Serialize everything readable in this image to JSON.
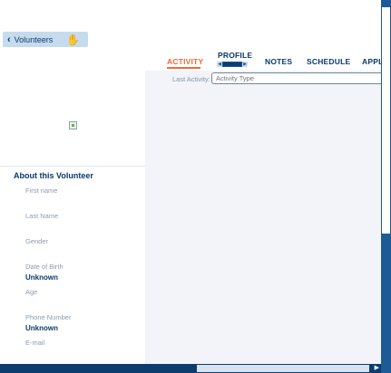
{
  "nav": {
    "back_label": "Volunteers",
    "back_chevron": "‹",
    "hand_icon": "✋"
  },
  "tabs": [
    {
      "label": "ACTIVITY",
      "active": true
    },
    {
      "label": "PROFILE",
      "active": false
    },
    {
      "label": "NOTES",
      "active": false
    },
    {
      "label": "SCHEDULE",
      "active": false
    },
    {
      "label": "APPL",
      "active": false
    }
  ],
  "activity": {
    "last_activity_label": "Last Activity:",
    "activity_type_placeholder": "Activity Type"
  },
  "profile": {
    "about_title": "About this Volunteer",
    "fields": [
      {
        "label": "First name",
        "value": ""
      },
      {
        "label": "Last Name",
        "value": ""
      },
      {
        "label": "Gender",
        "value": ""
      },
      {
        "label": "Date of Birth",
        "value": "Unknown"
      },
      {
        "label": "Age",
        "value": ""
      },
      {
        "label": "Phone Number",
        "value": "Unknown"
      },
      {
        "label": "E-mail",
        "value": ""
      }
    ]
  },
  "colors": {
    "accent": "#ef6b3a",
    "primary": "#0a3a6b",
    "scrollbar": "#1e5a96",
    "panel_bg": "#f3f4f9"
  }
}
